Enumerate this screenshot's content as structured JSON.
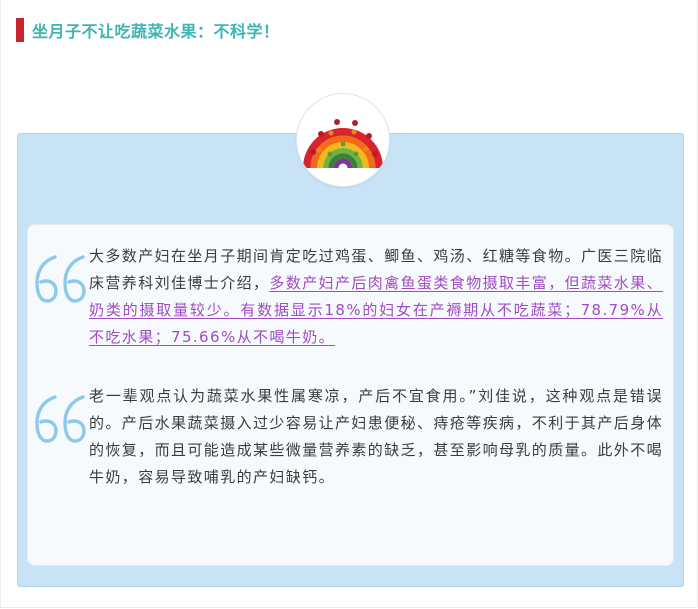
{
  "colors": {
    "accent_bar": "#c8242f",
    "title": "#3db5b4",
    "box_bg": "#c9e3f6",
    "card_bg": "#f7fafd",
    "quote_mark": "#8dc9ec",
    "link": "#a04cc2",
    "body_text": "#3c3c3c"
  },
  "header": {
    "title": "坐月子不让吃蔬菜水果：不科学！"
  },
  "badge": {
    "icon": "rainbow-vegetables-icon"
  },
  "quote1": {
    "icon": "quote-mark-icon",
    "text_before": "大多数产妇在坐月子期间肯定吃过鸡蛋、鲫鱼、鸡汤、红糖等食物。广医三院临床营养科刘佳博士介绍，",
    "link_text": "多数产妇产后肉禽鱼蛋类食物摄取丰富，但蔬菜水果、奶类的摄取量较少。有数据显示18%的妇女在产褥期从不吃蔬菜；78.79%从不吃水果；75.66%从不喝牛奶。"
  },
  "quote2": {
    "icon": "quote-mark-icon",
    "text": "老一辈观点认为蔬菜水果性属寒凉，产后不宜食用。”刘佳说，这种观点是错误的。产后水果蔬菜摄入过少容易让产妇患便秘、痔疮等疾病，不利于其产后身体的恢复，而且可能造成某些微量营养素的缺乏，甚至影响母乳的质量。此外不喝牛奶，容易导致哺乳的产妇缺钙。"
  }
}
